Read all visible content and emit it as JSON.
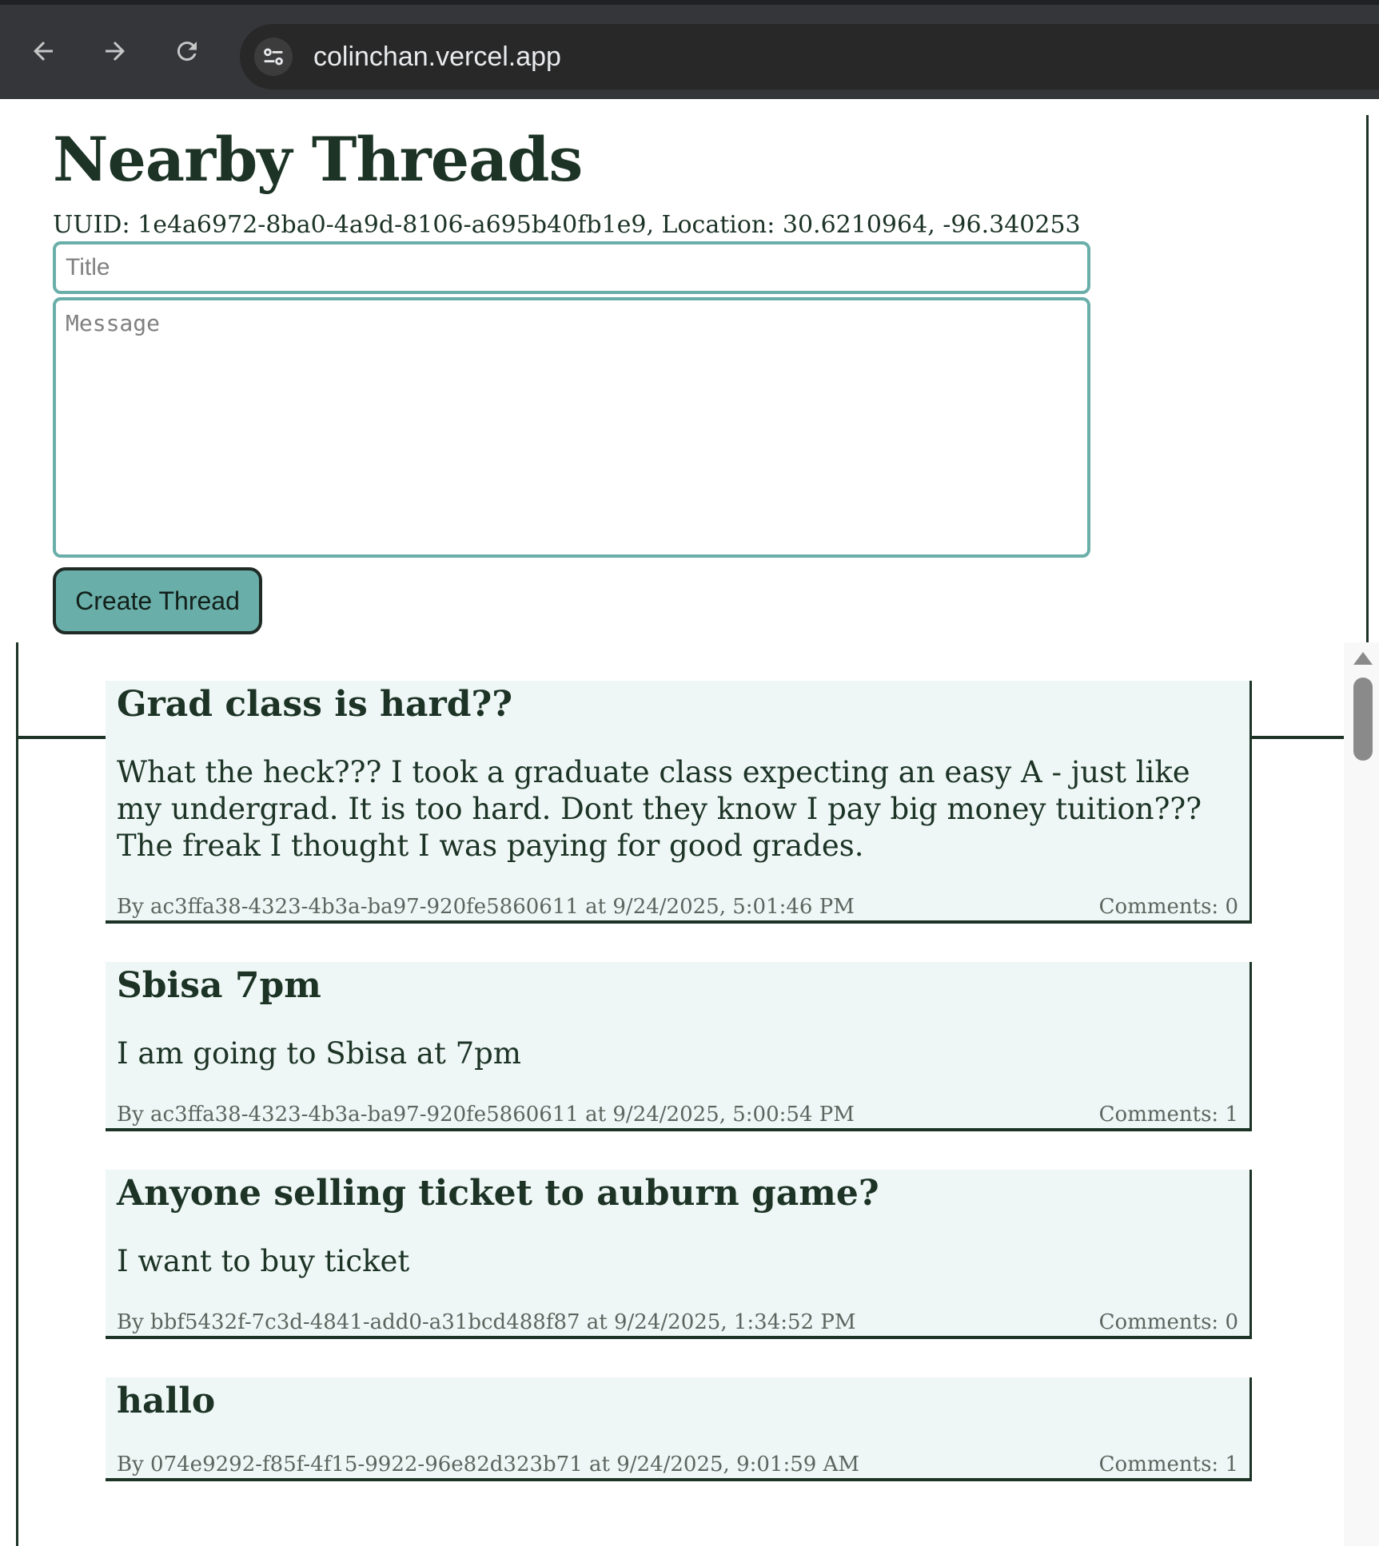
{
  "browser": {
    "url": "colinchan.vercel.app",
    "icons": {
      "back": "arrow-left-icon",
      "forward": "arrow-right-icon",
      "reload": "reload-icon",
      "site_info": "tune-icon"
    }
  },
  "header": {
    "title": "Nearby Threads",
    "info": "UUID: 1e4a6972-8ba0-4a9d-8106-a695b40fb1e9, Location: 30.6210964, -96.340253"
  },
  "form": {
    "title_placeholder": "Title",
    "title_value": "",
    "message_placeholder": "Message",
    "message_value": "",
    "submit_label": "Create Thread"
  },
  "threads": [
    {
      "title": "Grad class is hard??",
      "body": "What the heck??? I took a graduate class expecting an easy A - just like my undergrad. It is too hard. Dont they know I pay big money tuition??? The freak I thought I was paying for good grades.",
      "byline": "By ac3ffa38-4323-4b3a-ba97-920fe5860611 at 9/24/2025, 5:01:46 PM",
      "comments": "Comments: 0"
    },
    {
      "title": "Sbisa 7pm",
      "body": "I am going to Sbisa at 7pm",
      "byline": "By ac3ffa38-4323-4b3a-ba97-920fe5860611 at 9/24/2025, 5:00:54 PM",
      "comments": "Comments: 1"
    },
    {
      "title": "Anyone selling ticket to auburn game?",
      "body": "I want to buy ticket",
      "byline": "By bbf5432f-7c3d-4841-add0-a31bcd488f87 at 9/24/2025, 1:34:52 PM",
      "comments": "Comments: 0"
    },
    {
      "title": "hallo",
      "body": "",
      "byline": "By 074e9292-f85f-4f15-9922-96e82d323b71 at 9/24/2025, 9:01:59 AM",
      "comments": "Comments: 1"
    }
  ],
  "colors": {
    "accent": "#6aaea9",
    "ink": "#1c3326",
    "card_bg": "#eef7f5",
    "chrome_bg": "#35363a"
  }
}
